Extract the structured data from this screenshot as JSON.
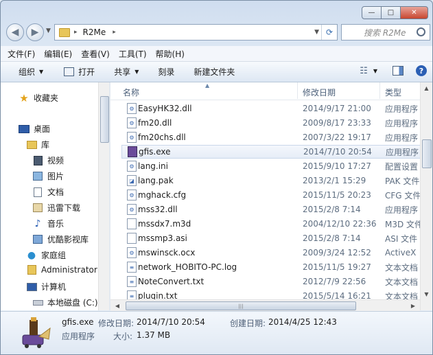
{
  "window": {
    "caption": {
      "minimize": "—",
      "maximize": "□",
      "close": "✕"
    }
  },
  "address": {
    "path": "R2Me",
    "separator": "▸",
    "search_placeholder": "搜索 R2Me"
  },
  "menubar": [
    "文件(F)",
    "编辑(E)",
    "查看(V)",
    "工具(T)",
    "帮助(H)"
  ],
  "toolbar": {
    "organize": "组织",
    "open": "打开",
    "share": "共享",
    "burn": "刻录",
    "new_folder": "新建文件夹"
  },
  "nav": {
    "favorites": "收藏夹",
    "desktop": "桌面",
    "libraries": "库",
    "videos": "视频",
    "pictures": "图片",
    "documents": "文档",
    "thunder": "迅雷下载",
    "music": "音乐",
    "youku": "优酷影视库",
    "homegroup": "家庭组",
    "admin": "Administrator",
    "computer": "计算机",
    "local_disk": "本地磁盘 (C:)"
  },
  "columns": {
    "name": "名称",
    "date": "修改日期",
    "type": "类型"
  },
  "files": [
    {
      "name": "EasyHK32.dll",
      "date": "2014/9/17 21:00",
      "type": "应用程序",
      "icon": "dll"
    },
    {
      "name": "fm20.dll",
      "date": "2009/8/17 23:33",
      "type": "应用程序",
      "icon": "dll"
    },
    {
      "name": "fm20chs.dll",
      "date": "2007/3/22 19:17",
      "type": "应用程序",
      "icon": "dll"
    },
    {
      "name": "gfis.exe",
      "date": "2014/7/10 20:54",
      "type": "应用程序",
      "icon": "exe",
      "selected": true
    },
    {
      "name": "lang.ini",
      "date": "2015/9/10 17:27",
      "type": "配置设置",
      "icon": "ini"
    },
    {
      "name": "lang.pak",
      "date": "2013/2/1 15:29",
      "type": "PAK 文件",
      "icon": "pak"
    },
    {
      "name": "mghack.cfg",
      "date": "2015/11/5 20:23",
      "type": "CFG 文件",
      "icon": "cfg"
    },
    {
      "name": "mss32.dll",
      "date": "2015/2/8 7:14",
      "type": "应用程序",
      "icon": "dll"
    },
    {
      "name": "mssdx7.m3d",
      "date": "2004/12/10 22:36",
      "type": "M3D 文件",
      "icon": "blank"
    },
    {
      "name": "mssmp3.asi",
      "date": "2015/2/8 7:14",
      "type": "ASI 文件",
      "icon": "blank"
    },
    {
      "name": "mswinsck.ocx",
      "date": "2009/3/24 12:52",
      "type": "ActiveX",
      "icon": "dll"
    },
    {
      "name": "network_HOBITO-PC.log",
      "date": "2015/11/5 19:27",
      "type": "文本文档",
      "icon": "txt"
    },
    {
      "name": "NoteConvert.txt",
      "date": "2012/7/9 22:56",
      "type": "文本文档",
      "icon": "txt"
    },
    {
      "name": "plugin.txt",
      "date": "2015/5/14 16:21",
      "type": "文本文档",
      "icon": "txt"
    }
  ],
  "details": {
    "filename": "gfis.exe",
    "kind": "应用程序",
    "modified_label": "修改日期:",
    "modified_value": "2014/7/10 20:54",
    "created_label": "创建日期:",
    "created_value": "2014/4/25 12:43",
    "size_label": "大小:",
    "size_value": "1.37 MB"
  },
  "colors": {
    "selection": "#e6edf7",
    "accent": "#2b5fb4",
    "header_text": "#4c607a"
  }
}
